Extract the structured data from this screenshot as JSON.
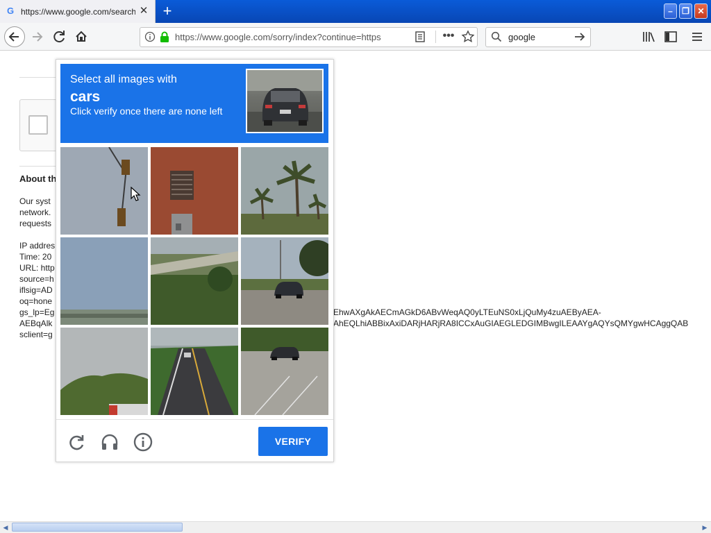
{
  "browser": {
    "tab_title": "https://www.google.com/search?q",
    "tab_favicon": "G",
    "url": "https://www.google.com/sorry/index?continue=https",
    "search_value": "google"
  },
  "background_page": {
    "heading": "About th",
    "paragraph_lines": [
      "Our syst",
      "network.",
      "requests"
    ],
    "details_lines": [
      "IP addres",
      "Time: 20",
      "URL: http",
      "source=h",
      "iflsig=AD",
      "oq=hone",
      "gs_lp=Eg",
      "AEBqAlk",
      "sclient=g"
    ],
    "overflow_line_1": "EhwAXgAkAECmAGkD6ABvWeqAQ0yLTEuNS0xLjQuMy4zuAEByAEA-",
    "overflow_line_2": "AhEQLhiABBixAxiDARjHARjRA8ICCxAuGIAEGLEDGIMBwgILEAAYgAQYsQMYgwHCAggQAB"
  },
  "captcha": {
    "instruction": "Select all images with",
    "target": "cars",
    "subtext": "Click verify once there are none left",
    "verify_label": "VERIFY",
    "accent_color": "#1a73e8",
    "tiles": [
      {
        "name": "traffic-light"
      },
      {
        "name": "brick-building"
      },
      {
        "name": "palm-trees"
      },
      {
        "name": "sky-horizon"
      },
      {
        "name": "vegetation-bridge"
      },
      {
        "name": "parking-lot-car"
      },
      {
        "name": "sky-trees"
      },
      {
        "name": "road"
      },
      {
        "name": "parking-lot-suv"
      }
    ]
  },
  "icons": {
    "reload": "reload-icon",
    "audio": "headphones-icon",
    "info": "info-icon"
  }
}
